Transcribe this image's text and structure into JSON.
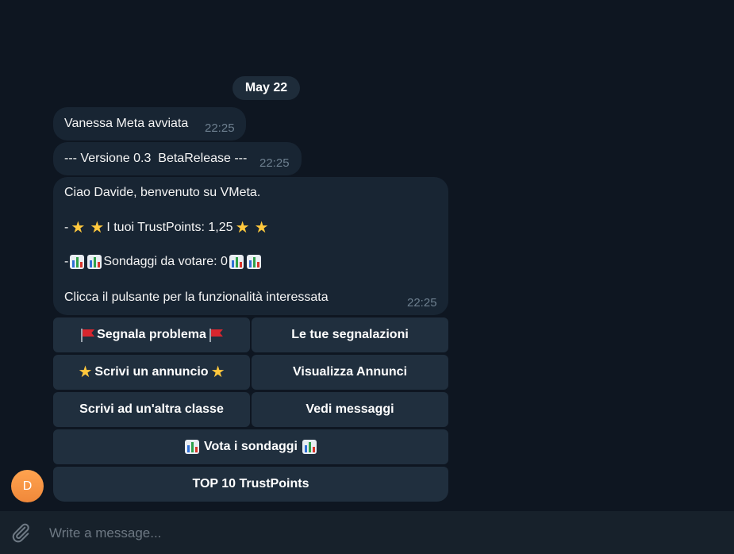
{
  "chat": {
    "date_label": "May 22",
    "messages": [
      {
        "text": "Vanessa Meta avviata",
        "time": "22:25"
      },
      {
        "text": "--- Versione 0.3  BetaRelease ---",
        "time": "22:25"
      },
      {
        "greeting": "Ciao Davide, benvenuto su VMeta.",
        "trust_prefix": "-",
        "trust_text": "I tuoi TrustPoints: 1,25",
        "polls_prefix": "-",
        "polls_text": "Sondaggi da votare: 0",
        "cta": "Clicca il pulsante per la funzionalità interessata",
        "time": "22:25"
      }
    ],
    "keyboard": {
      "report_problem": "Segnala problema",
      "your_reports": "Le tue segnalazioni",
      "write_ad": "Scrivi un annuncio",
      "view_ads": "Visualizza Annunci",
      "write_other_class": "Scrivi ad un'altra classe",
      "view_messages": "Vedi messaggi",
      "vote_polls": " Vota i sondaggi ",
      "top10": "TOP 10 TrustPoints"
    },
    "avatar_initial": "D"
  },
  "composer": {
    "placeholder": "Write a message..."
  },
  "icons": {
    "attach": "paperclip-icon",
    "star": "glowing-star-emoji",
    "chart": "bar-chart-emoji",
    "flag": "red-flag-emoji"
  },
  "colors": {
    "background": "#0e1621",
    "bubble": "#182533",
    "keyboard_button": "#202f3e",
    "composer": "#17212b",
    "timestamp": "#6d7f8f",
    "avatar": "#f0883a"
  }
}
